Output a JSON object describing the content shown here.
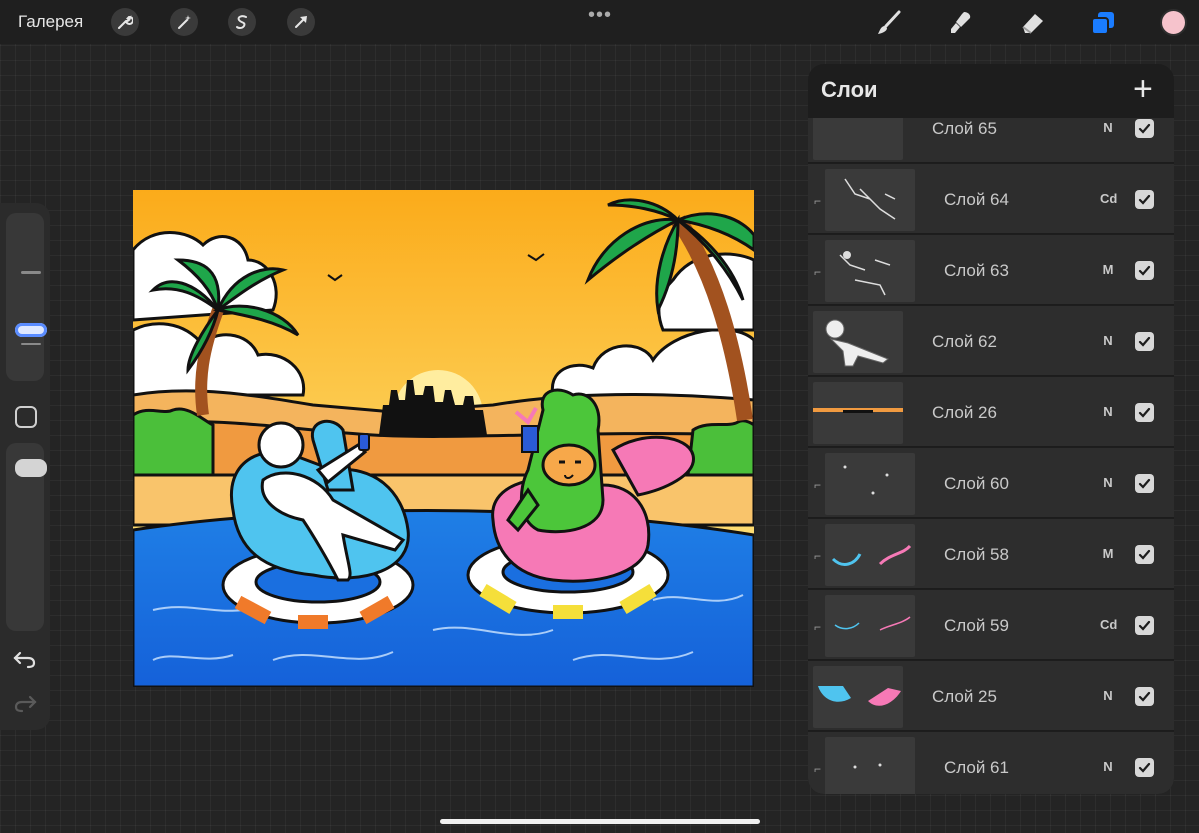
{
  "topbar": {
    "gallery_label": "Галерея",
    "left_tools": [
      "wrench-icon",
      "magic-wand-icon",
      "selection-s-icon",
      "transform-arrow-icon"
    ],
    "more_label": "•••",
    "right_tools": [
      "brush-icon",
      "smudge-icon",
      "eraser-icon",
      "layers-icon"
    ],
    "active_tool": "layers-icon",
    "active_color": "#f6c3cc",
    "accent": "#1a7cff"
  },
  "sidebar": {
    "undo_icon": "undo-icon",
    "redo_icon": "redo-icon",
    "modify_icon": "square-modify-icon"
  },
  "layers": {
    "title": "Слои",
    "add_label": "+",
    "items": [
      {
        "name": "Слой 65",
        "mode": "N",
        "clipped": false,
        "visible": true
      },
      {
        "name": "Слой 64",
        "mode": "Cd",
        "clipped": true,
        "visible": true
      },
      {
        "name": "Слой 63",
        "mode": "M",
        "clipped": true,
        "visible": true
      },
      {
        "name": "Слой 62",
        "mode": "N",
        "clipped": false,
        "visible": true
      },
      {
        "name": "Слой 26",
        "mode": "N",
        "clipped": false,
        "visible": true
      },
      {
        "name": "Слой 60",
        "mode": "N",
        "clipped": true,
        "visible": true
      },
      {
        "name": "Слой 58",
        "mode": "M",
        "clipped": true,
        "visible": true
      },
      {
        "name": "Слой 59",
        "mode": "Cd",
        "clipped": true,
        "visible": true
      },
      {
        "name": "Слой 25",
        "mode": "N",
        "clipped": false,
        "visible": true
      },
      {
        "name": "Слой 61",
        "mode": "N",
        "clipped": true,
        "visible": true
      }
    ]
  }
}
